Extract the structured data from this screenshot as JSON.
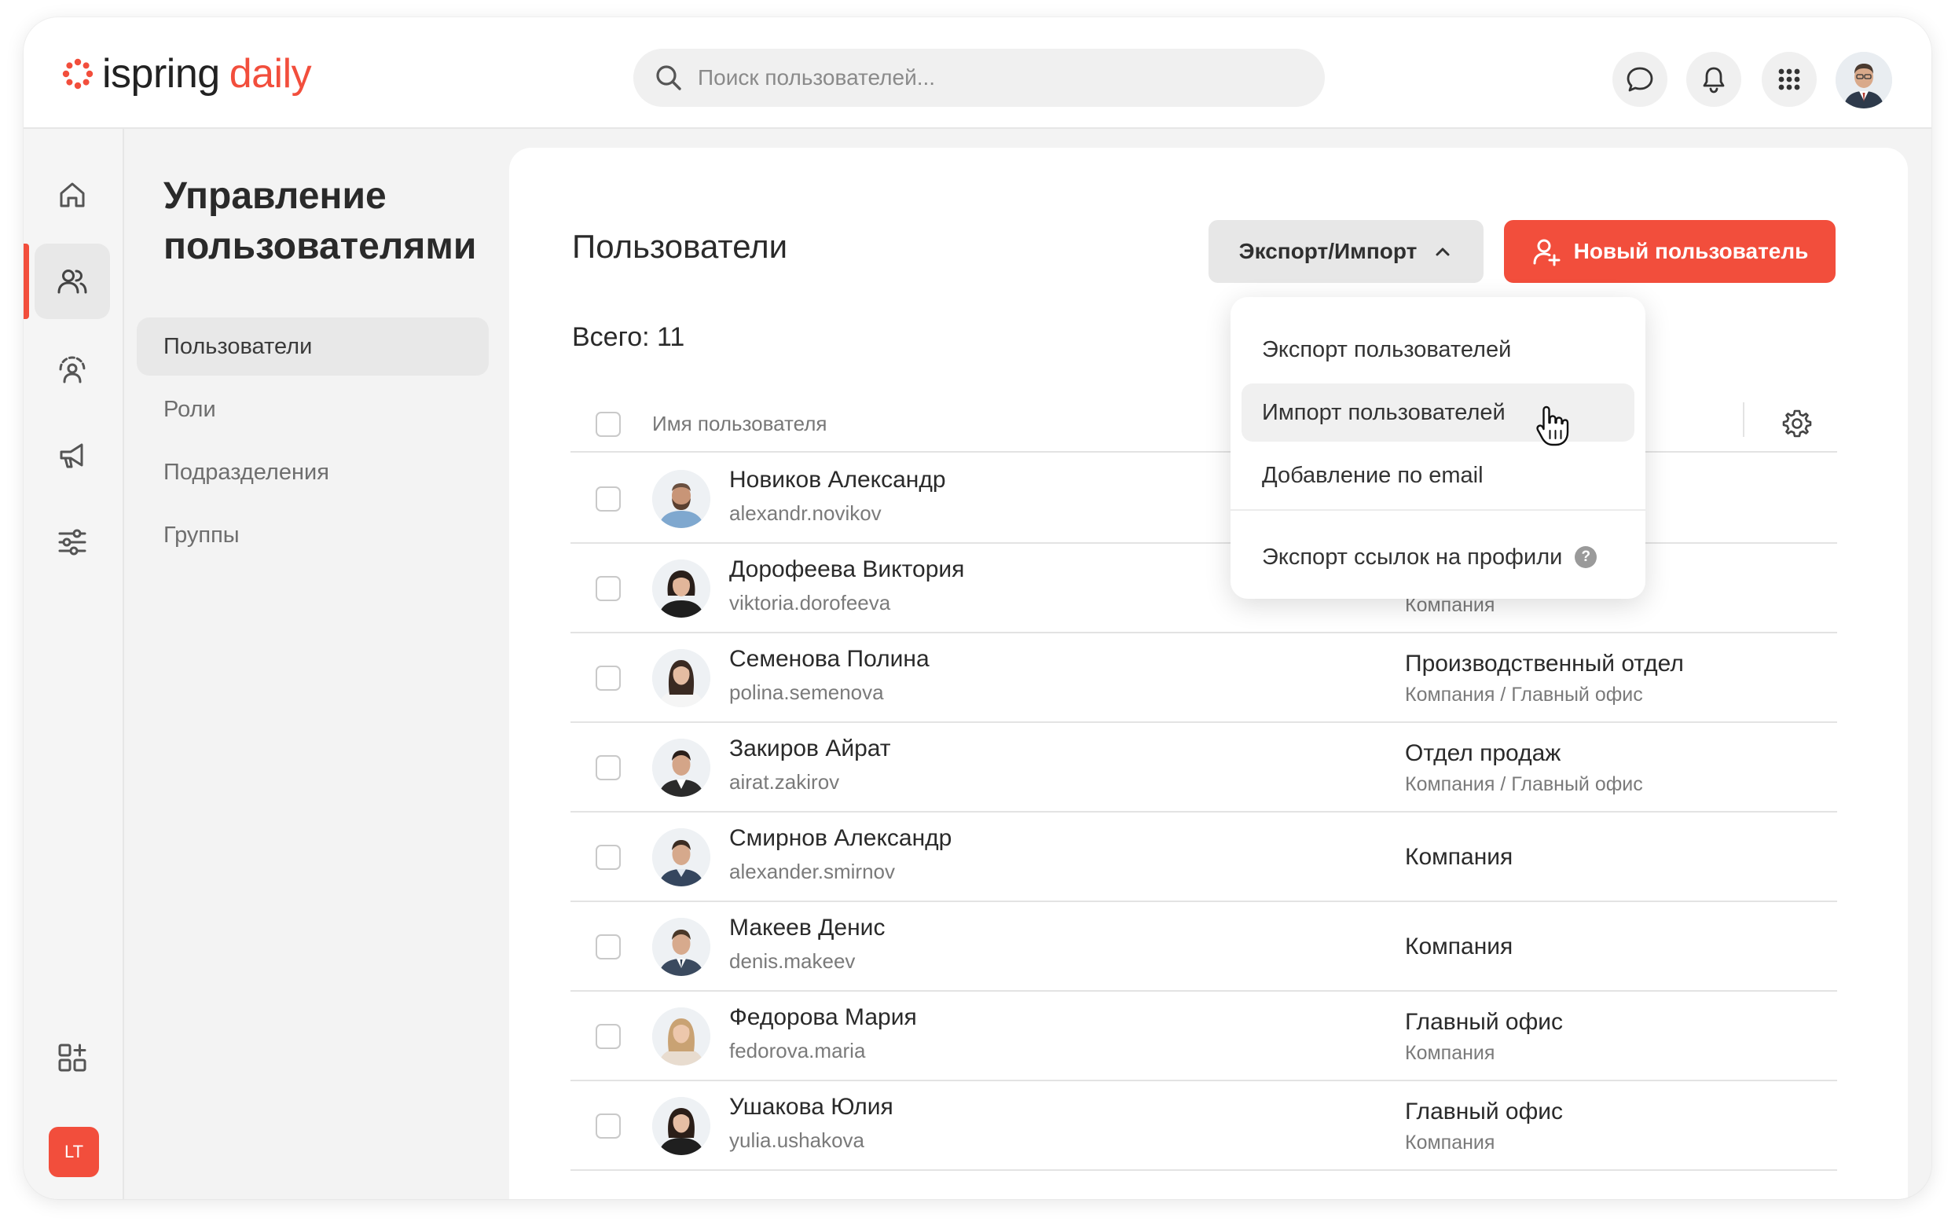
{
  "app": {
    "logo_main": "ispring",
    "logo_accent": "daily",
    "brand_color": "#f24e3c"
  },
  "topbar": {
    "search_placeholder": "Поиск пользователей...",
    "icons": [
      "chat-icon",
      "bell-icon",
      "apps-grid-icon"
    ],
    "current_user_avatar": "avatar"
  },
  "rail": {
    "items": [
      "home-icon",
      "users-icon",
      "training-icon",
      "announcements-icon",
      "settings-sliders-icon"
    ],
    "bottom_icon": "add-app-icon",
    "account_badge": "LT"
  },
  "subnav": {
    "title": "Управление пользователями",
    "items": [
      {
        "label": "Пользователи",
        "active": true
      },
      {
        "label": "Роли",
        "active": false
      },
      {
        "label": "Подразделения",
        "active": false
      },
      {
        "label": "Группы",
        "active": false
      }
    ]
  },
  "main": {
    "title": "Пользователи",
    "export_import_label": "Экспорт/Импорт",
    "new_user_label": "Новый пользователь",
    "total_label": "Всего: 11",
    "column_name": "Имя пользователя"
  },
  "dropdown": {
    "items": [
      "Экспорт пользователей",
      "Импорт пользователей",
      "Добавление по email",
      "Экспорт ссылок на профили"
    ],
    "help_glyph": "?",
    "hovered_index": 1
  },
  "users": [
    {
      "name": "Новиков Александр",
      "login": "alexandr.novikov",
      "dept": "",
      "path": ""
    },
    {
      "name": "Дорофеева Виктория",
      "login": "viktoria.dorofeeva",
      "dept": "",
      "path": "Компания"
    },
    {
      "name": "Семенова Полина",
      "login": "polina.semenova",
      "dept": "Производственный отдел",
      "path": "Компания / Главный офис"
    },
    {
      "name": "Закиров Айрат",
      "login": "airat.zakirov",
      "dept": "Отдел продаж",
      "path": "Компания / Главный офис"
    },
    {
      "name": "Смирнов Александр",
      "login": "alexander.smirnov",
      "dept": "Компания",
      "path": ""
    },
    {
      "name": "Макеев Денис",
      "login": "denis.makeev",
      "dept": "Компания",
      "path": ""
    },
    {
      "name": "Федорова Мария",
      "login": "fedorova.maria",
      "dept": "Главный офис",
      "path": "Компания"
    },
    {
      "name": "Ушакова Юлия",
      "login": "yulia.ushakova",
      "dept": "Главный офис",
      "path": "Компания"
    }
  ]
}
